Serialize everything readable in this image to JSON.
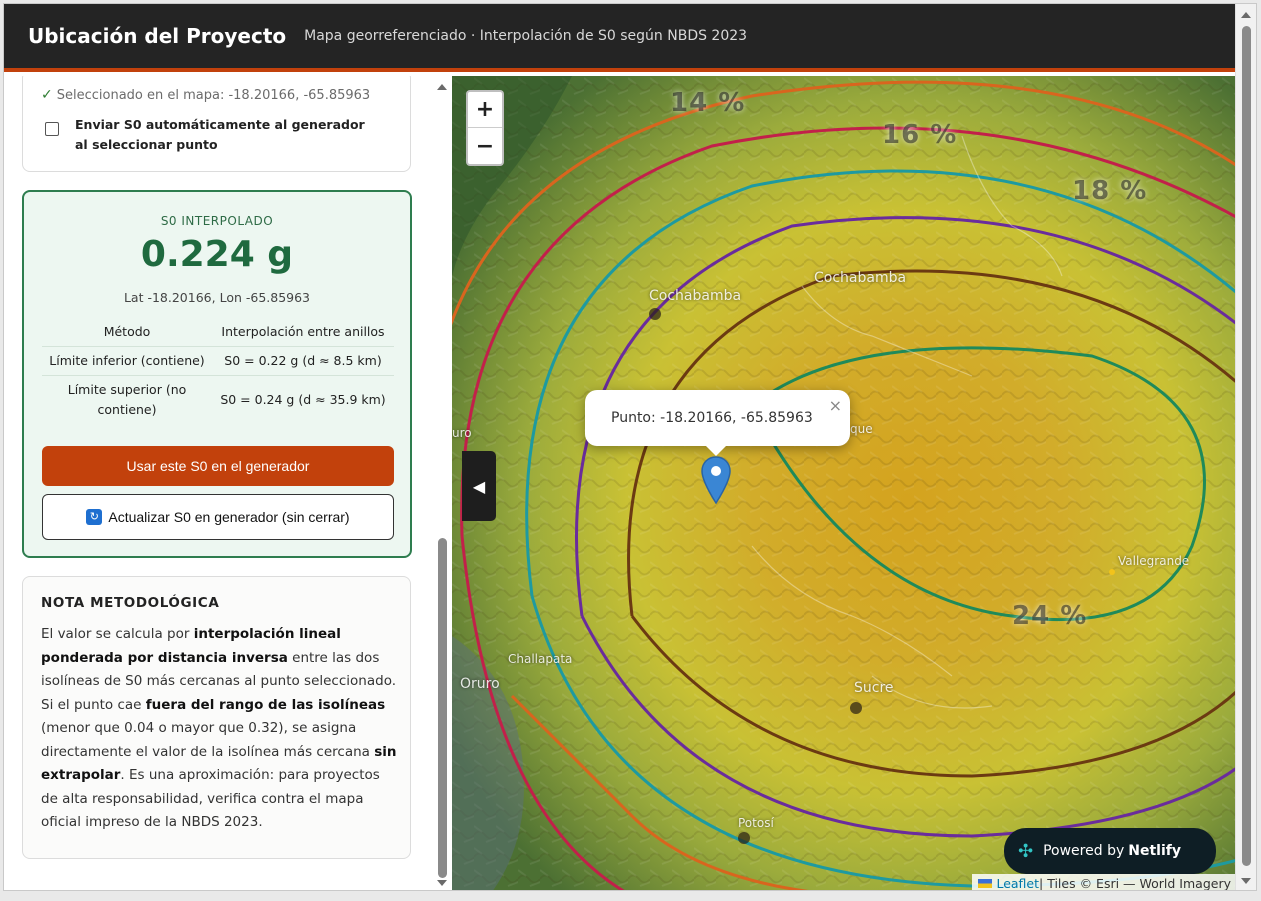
{
  "header": {
    "title": "Ubicación del Proyecto",
    "subtitle": "Mapa georreferenciado · Interpolación de S0 según NBDS 2023"
  },
  "selection": {
    "selected_text": "Seleccionado en el mapa: -18.20166, -65.85963",
    "auto_send_label": "Enviar S0 automáticamente al generador al seleccionar punto",
    "auto_send_checked": false
  },
  "result": {
    "caption": "S0 INTERPOLADO",
    "value": "0.224 g",
    "coords": "Lat -18.20166, Lon -65.85963",
    "rows": [
      {
        "label": "Método",
        "value": "Interpolación entre anillos"
      },
      {
        "label": "Límite inferior (contiene)",
        "value": "S0 = 0.22 g (d ≈ 8.5 km)"
      },
      {
        "label": "Límite superior (no contiene)",
        "value": "S0 = 0.24 g (d ≈ 35.9 km)"
      }
    ],
    "use_button": "Usar este S0 en el generador",
    "update_button": "Actualizar S0 en generador (sin cerrar)"
  },
  "note": {
    "title": "NOTA METODOLÓGICA",
    "p1": "El valor se calcula por ",
    "b1": "interpolación lineal ponderada por distancia inversa",
    "p2": " entre las dos isolíneas de S0 más cercanas al punto seleccionado. Si el punto cae ",
    "b2": "fuera del rango de las isolíneas",
    "p3": " (menor que 0.04 o mayor que 0.32), se asigna directamente el valor de la isolínea más cercana ",
    "b3": "sin extrapolar",
    "p4": ". Es una aproximación: para proyectos de alta responsabilidad, verifica contra el mapa oficial impreso de la NBDS 2023."
  },
  "map": {
    "zoom_in": "+",
    "zoom_out": "−",
    "collapse": "◀",
    "popup_text": "Punto: -18.20166, -65.85963",
    "popup_close": "×",
    "isoline_labels": [
      "14 %",
      "16 %",
      "18 %",
      "24 %"
    ],
    "places": [
      "Cochabamba",
      "Cochabamba",
      "Sucre",
      "Challapata",
      "Oruro",
      "Potosí",
      "Vallegrande",
      "que",
      "uro"
    ],
    "netlify_prefix": "Powered by",
    "netlify_brand": "Netlify",
    "attribution_link": "Leaflet",
    "attribution_text": " | Tiles © Esri — World Imagery",
    "colors": {
      "orange": "#d9651e",
      "crimson": "#c2204a",
      "teal": "#1e9aa0",
      "purple": "#6a2c9c",
      "brown": "#6b3a12",
      "green": "#1f8a5a"
    }
  }
}
